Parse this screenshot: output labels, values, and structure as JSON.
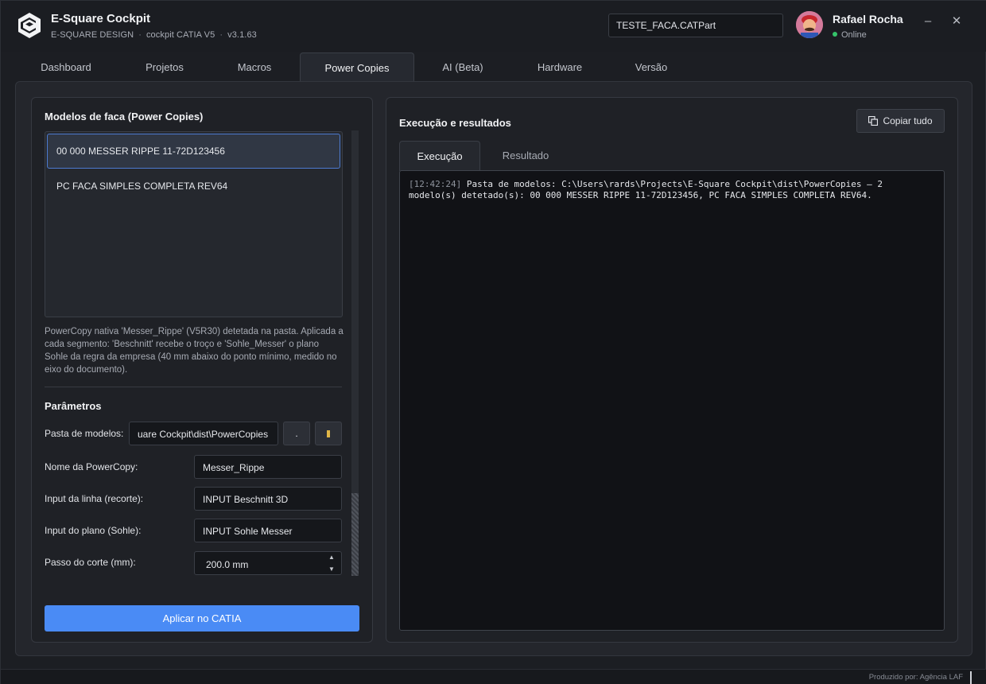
{
  "app": {
    "title": "E-Square Cockpit",
    "subtitle_brand": "E-SQUARE DESIGN",
    "subtitle_product": "cockpit CATIA V5",
    "version": "v3.1.63",
    "current_file": "TESTE_FACA.CATPart"
  },
  "user": {
    "name": "Rafael Rocha",
    "status": "Online",
    "status_color": "#35c46a"
  },
  "window_controls": {
    "minimize": "–",
    "close": "✕"
  },
  "tabs": [
    {
      "label": "Dashboard",
      "active": false
    },
    {
      "label": "Projetos",
      "active": false
    },
    {
      "label": "Macros",
      "active": false
    },
    {
      "label": "Power Copies",
      "active": true
    },
    {
      "label": "AI (Beta)",
      "active": false
    },
    {
      "label": "Hardware",
      "active": false
    },
    {
      "label": "Versão",
      "active": false
    }
  ],
  "models": {
    "title": "Modelos de faca (Power Copies)",
    "items": [
      {
        "label": "00 000 MESSER RIPPE 11-72D123456",
        "selected": true
      },
      {
        "label": "PC FACA SIMPLES COMPLETA REV64",
        "selected": false
      }
    ],
    "description": "PowerCopy nativa 'Messer_Rippe' (V5R30) detetada na pasta. Aplicada a cada segmento: 'Beschnitt' recebe o troço e 'Sohle_Messer' o plano Sohle da regra da empresa (40 mm abaixo do ponto mínimo, medido no eixo do documento)."
  },
  "params": {
    "title": "Parâmetros",
    "folder_label": "Pasta de modelos:",
    "folder_value": "uare Cockpit\\dist\\PowerCopies",
    "folder_btn_dot": ".",
    "powercopy_label": "Nome da PowerCopy:",
    "powercopy_value": "Messer_Rippe",
    "line_label": "Input da linha (recorte):",
    "line_value": "INPUT Beschnitt 3D",
    "plane_label": "Input do plano (Sohle):",
    "plane_value": "INPUT Sohle Messer",
    "step_label": "Passo do corte (mm):",
    "step_value": "200.0 mm",
    "spin_up": "▲",
    "spin_down": "▼"
  },
  "apply_button": "Aplicar no CATIA",
  "results": {
    "title": "Execução e resultados",
    "copy_button": "Copiar tudo",
    "tabs": [
      {
        "label": "Execução",
        "active": true
      },
      {
        "label": "Resultado",
        "active": false
      }
    ],
    "log_timestamp": "[12:42:24]",
    "log_message": "Pasta de modelos: C:\\Users\\rards\\Projects\\E-Square Cockpit\\dist\\PowerCopies — 2 modelo(s) detetado(s): 00 000 MESSER RIPPE 11-72D123456, PC FACA SIMPLES COMPLETA REV64."
  },
  "footer": {
    "credit": "Produzido por: Agência LAF"
  },
  "colors": {
    "accent": "#4a8bf5",
    "selection_border": "#4d7bd1",
    "background": "#1c1e23"
  }
}
